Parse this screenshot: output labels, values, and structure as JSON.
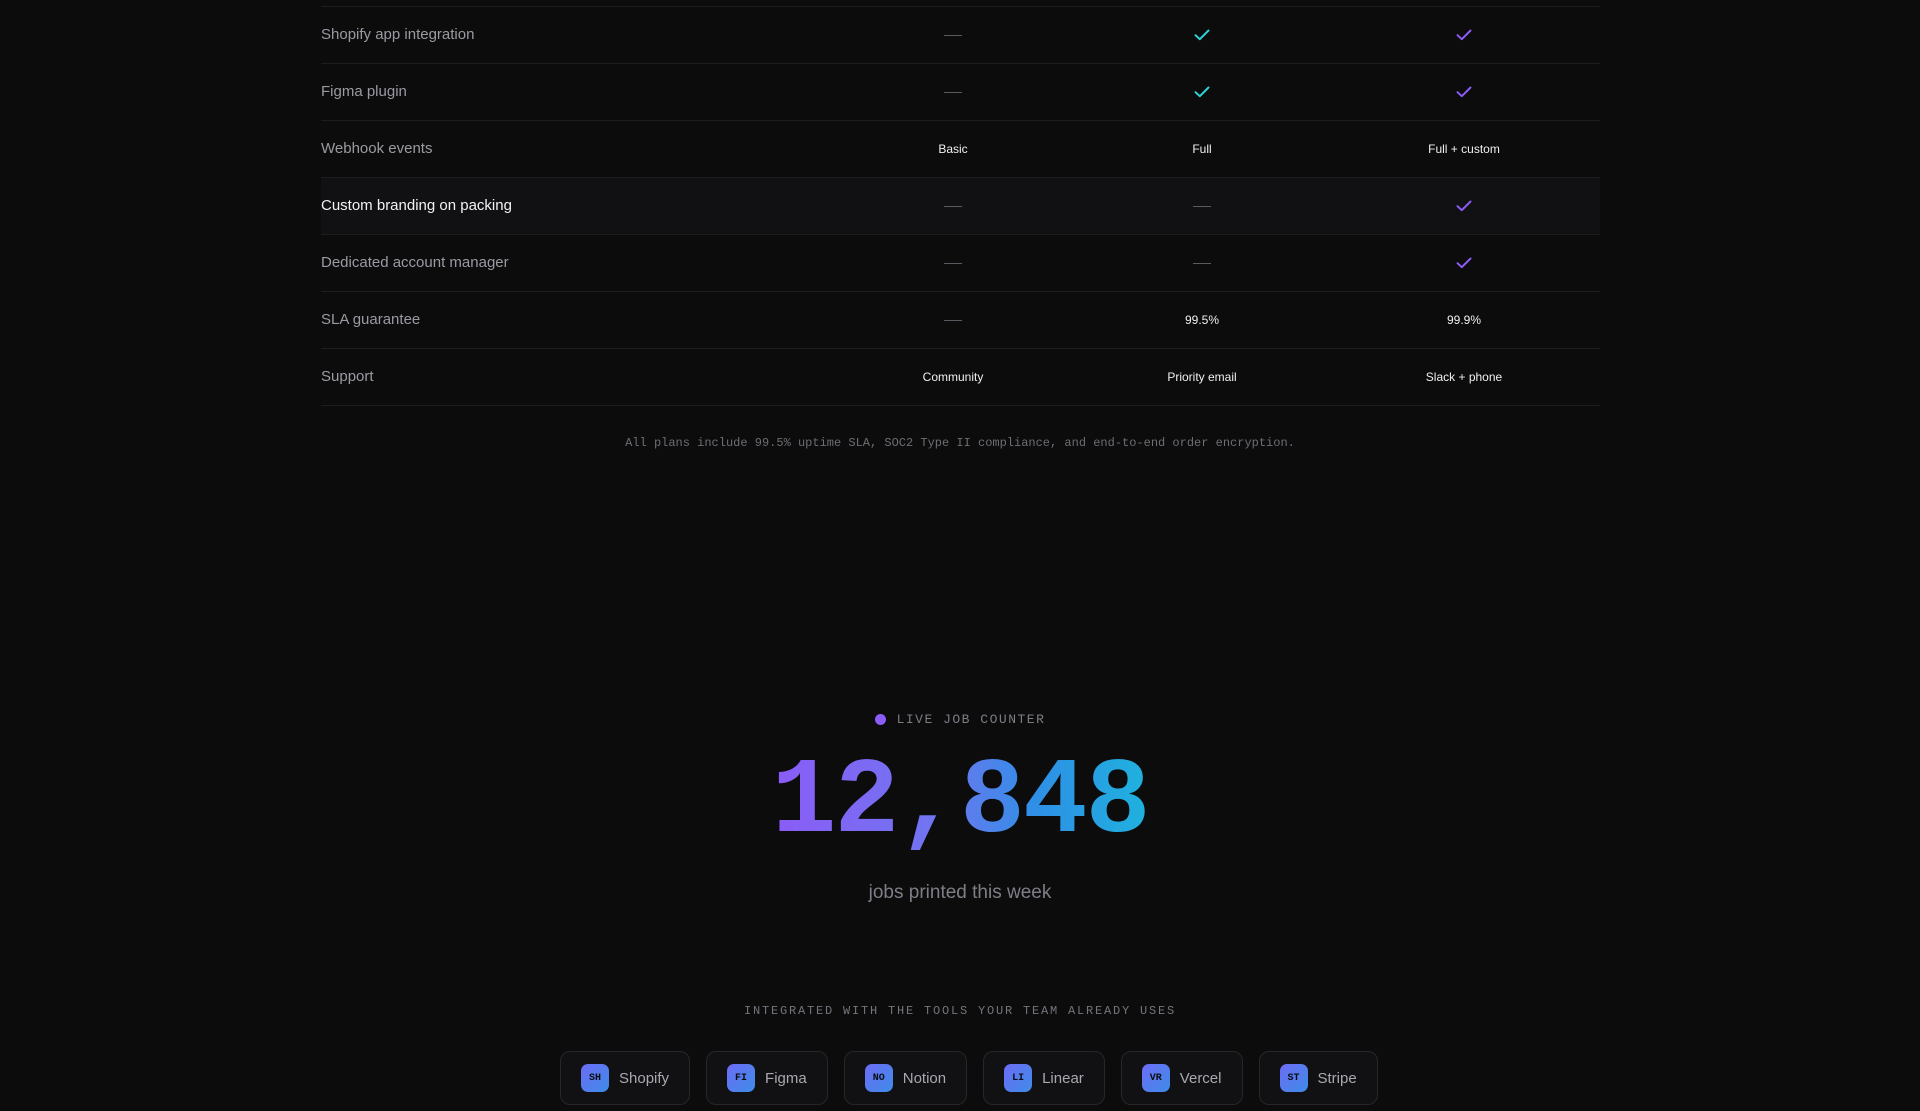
{
  "comparison": {
    "rows": [
      {
        "feature": "Shopify app integration",
        "cells": [
          {
            "type": "dash"
          },
          {
            "type": "check",
            "color": "#2dd4d8"
          },
          {
            "type": "check",
            "color": "#8b5cf6"
          }
        ]
      },
      {
        "feature": "Figma plugin",
        "cells": [
          {
            "type": "dash"
          },
          {
            "type": "check",
            "color": "#2dd4d8"
          },
          {
            "type": "check",
            "color": "#8b5cf6"
          }
        ]
      },
      {
        "feature": "Webhook events",
        "cells": [
          {
            "type": "text",
            "value": "Basic"
          },
          {
            "type": "text",
            "value": "Full"
          },
          {
            "type": "text",
            "value": "Full + custom"
          }
        ]
      },
      {
        "feature": "Custom branding on packing",
        "highlight": true,
        "cells": [
          {
            "type": "dash"
          },
          {
            "type": "dash"
          },
          {
            "type": "check",
            "color": "#8b5cf6"
          }
        ]
      },
      {
        "feature": "Dedicated account manager",
        "cells": [
          {
            "type": "dash"
          },
          {
            "type": "dash"
          },
          {
            "type": "check",
            "color": "#8b5cf6"
          }
        ]
      },
      {
        "feature": "SLA guarantee",
        "cells": [
          {
            "type": "dash"
          },
          {
            "type": "text",
            "value": "99.5%"
          },
          {
            "type": "text",
            "value": "99.9%"
          }
        ]
      },
      {
        "feature": "Support",
        "cells": [
          {
            "type": "text",
            "value": "Community"
          },
          {
            "type": "text",
            "value": "Priority email"
          },
          {
            "type": "text",
            "value": "Slack + phone"
          }
        ]
      }
    ],
    "footnote": "All plans include 99.5% uptime SLA, SOC2 Type II compliance, and end-to-end order encryption."
  },
  "counter": {
    "label": "LIVE JOB COUNTER",
    "value": "12,848",
    "caption": "jobs printed this week",
    "dot_color": "#8b5cf6"
  },
  "integrations": {
    "title": "INTEGRATED WITH THE TOOLS YOUR TEAM ALREADY USES",
    "tools": [
      {
        "abbr": "SH",
        "name": "Shopify"
      },
      {
        "abbr": "FI",
        "name": "Figma"
      },
      {
        "abbr": "NO",
        "name": "Notion"
      },
      {
        "abbr": "LI",
        "name": "Linear"
      },
      {
        "abbr": "VR",
        "name": "Vercel"
      },
      {
        "abbr": "ST",
        "name": "Stripe"
      }
    ]
  }
}
